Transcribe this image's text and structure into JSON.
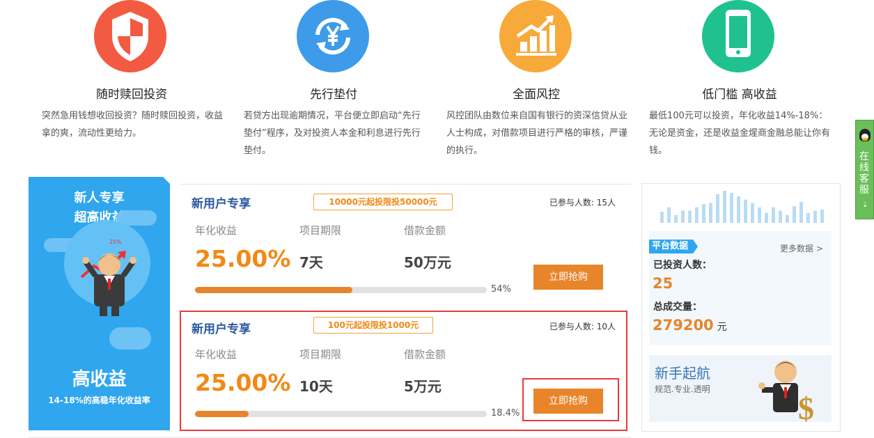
{
  "features": [
    {
      "title": "随时赎回投资",
      "desc": "突然急用钱想收回投资？随时赎回投资，收益拿的爽，流动性更给力。",
      "icon": "shield-icon",
      "color": "#f25a41"
    },
    {
      "title": "先行垫付",
      "desc": "若贷方出现逾期情况，平台便立即启动“先行垫付”程序，及对投资人本金和利息进行先行垫付。",
      "icon": "yen-exchange-icon",
      "color": "#3d9be9"
    },
    {
      "title": "全面风控",
      "desc": "风控团队由数位来自国有银行的资深信贷从业人士构成，对借款项目进行严格的审核，严谨的执行。",
      "icon": "growth-chart-icon",
      "color": "#f7a93a"
    },
    {
      "title": "低门槛 高收益",
      "desc": "最低100元可以投资，年化收益14%-18%：无论是资金，还是收益金煋商金融总能让你有钱。",
      "icon": "mobile-phone-icon",
      "color": "#1fc28e"
    }
  ],
  "promo": {
    "line1": "新人专享",
    "line2": "超高收益",
    "badge": "25%",
    "big": "高收益",
    "small": "14-18%的高稳年化收益率"
  },
  "labels": {
    "rate": "年化收益",
    "term": "项目期限",
    "amount": "借款金额"
  },
  "products": [
    {
      "title": "新用户专享",
      "tag": "10000元起投限投50000元",
      "count": "已参与人数: 15人",
      "rate": "25.00%",
      "term": "7天",
      "amount": "50万元",
      "progress": 54,
      "progress_text": "54%",
      "button": "立即抢购"
    },
    {
      "title": "新用户专享",
      "tag": "100元起投限投1000元",
      "count": "已参与人数: 10人",
      "rate": "25.00%",
      "term": "10天",
      "amount": "5万元",
      "progress": 18.4,
      "progress_text": "18.4%",
      "button": "立即抢购"
    }
  ],
  "stats": {
    "header": "平台数据",
    "more": "更多数据 >",
    "investors_label": "已投资人数：",
    "investors": "25",
    "volume_label": "总成交量：",
    "volume": "279200",
    "volume_unit": "元",
    "bars": [
      20,
      28,
      14,
      22,
      22,
      28,
      34,
      36,
      52,
      58,
      54,
      48,
      42,
      36,
      28,
      18,
      28,
      22,
      14,
      30,
      38,
      18,
      22,
      24
    ]
  },
  "guide": {
    "title": "新手起航",
    "subtitle": "规范.专业.透明"
  },
  "service": {
    "label": "在线客服"
  },
  "colors": {
    "blue": "#2fa6ee",
    "orange": "#e8842a",
    "highlight": "#e53b3b",
    "title_blue": "#2a5aa0"
  }
}
